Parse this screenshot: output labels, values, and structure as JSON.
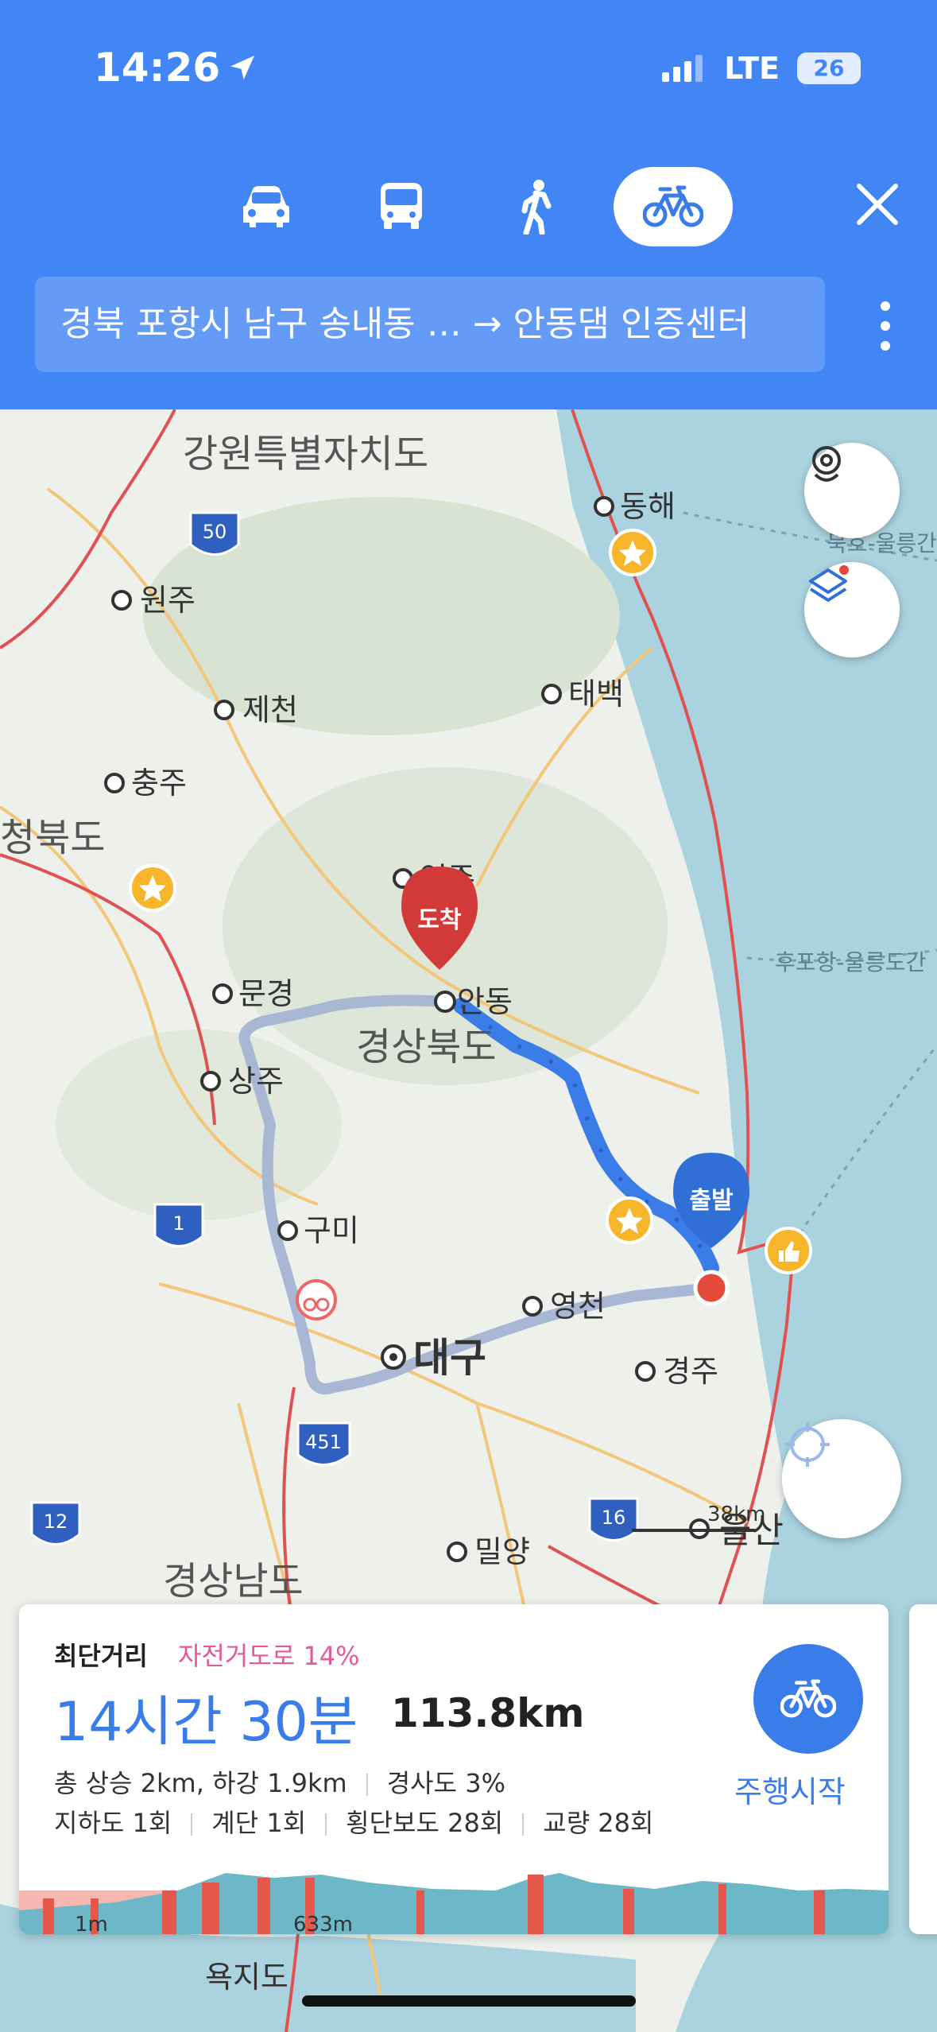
{
  "status": {
    "time": "14:26",
    "network": "LTE",
    "battery": "26"
  },
  "modes": [
    "car-icon",
    "bus-icon",
    "walk-icon",
    "bicycle-icon"
  ],
  "route": {
    "summary": "경북 포항시 남구 송내동 … → 안동댐 인증센터"
  },
  "map": {
    "labels": {
      "gangwon": "강원특별자치도",
      "wonju": "원주",
      "jecheon": "제천",
      "chungju": "충주",
      "chungbuk": "청북도",
      "donghae": "동해",
      "taebaek": "태백",
      "yeongju": "영주",
      "andong": "안동",
      "mungyeong": "문경",
      "sangju": "상주",
      "gyeongbuk": "경상북도",
      "gumi": "구미",
      "daegu": "대구",
      "yeongcheon": "영천",
      "gyeongju": "경주",
      "miryang": "밀양",
      "ulsan": "울산",
      "gyeongnam": "경상남도",
      "yokjido": "욕지도",
      "ferry1": "묵호-울릉간",
      "ferry2": "후포항-울릉도간",
      "scale": "38km"
    },
    "highways": [
      "50",
      "1",
      "451",
      "12",
      "16"
    ],
    "markers": {
      "destination": "도착",
      "origin": "출발"
    }
  },
  "card": {
    "route_type": "최단거리",
    "bike_share": "자전거도로 14%",
    "duration": "14시간 30분",
    "distance": "113.8km",
    "stats1": "총 상승 2km, 하강 1.9km",
    "stats1b": "경사도 3%",
    "underpass": "지하도 1회",
    "stairs": "계단 1회",
    "crosswalk": "횡단보도 28회",
    "bridge": "교량 28회",
    "start": "주행시작",
    "elev_min": "1m",
    "elev_max": "633m"
  },
  "colors": {
    "header": "#4285f4",
    "route": "#3b7de8",
    "alt_route": "#a7b7d4",
    "destination": "#d23a3a",
    "accent": "#3b7de8"
  }
}
